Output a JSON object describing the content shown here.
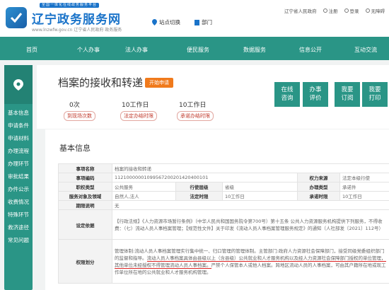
{
  "header": {
    "tagline": "全国一体化在线政务服务平台",
    "site_name": "辽宁政务服务网",
    "site_sub": "www.lnzwfw.gov.cn  辽宁省人民政府 政务服务",
    "site_switch": "站点切换",
    "dept": "部门",
    "gov_link": "辽宁省人民政府",
    "register": "注册",
    "login": "登录",
    "accessibility": "无障碍"
  },
  "nav": [
    "首页",
    "个人办事",
    "法人办事",
    "便民服务",
    "数据服务",
    "信息公开",
    "互动交流"
  ],
  "sidebar": {
    "items": [
      "基本信息",
      "申请条件",
      "申请材料",
      "办理流程",
      "办理环节",
      "审批结果",
      "办件公示",
      "收费情况",
      "特殊环节",
      "救济途径",
      "常见问题"
    ]
  },
  "service": {
    "title": "档案的接收和转递",
    "badge": "开始申请",
    "stats": [
      {
        "value": "0次",
        "label": "到现场次数"
      },
      {
        "value": "10工作日",
        "label": "法定办结时限"
      },
      {
        "value": "10工作日",
        "label": "承诺办结时限"
      }
    ],
    "actions": [
      {
        "line1": "在线",
        "line2": "咨询"
      },
      {
        "line1": "办事",
        "line2": "评价"
      },
      {
        "line1": "我要",
        "line2": "订阅"
      },
      {
        "line1": "我要",
        "line2": "打印"
      }
    ]
  },
  "basic_info": {
    "title": "基本信息",
    "rows": {
      "item_name_k": "事项名称",
      "item_name_v": "档案的接收和转递",
      "item_code_k": "事项编码",
      "item_code_v": "112100000010995672002014204001​01",
      "power_source_k": "权力来源",
      "power_source_v": "法定本级行使",
      "item_type_k": "职权类型",
      "item_type_v": "公共服务",
      "level_k": "行使层级",
      "level_v": "省级",
      "handle_type_k": "办理类型",
      "handle_type_v": "承诺件",
      "target_k": "服务对象及领域",
      "target_v": "自然人,法人",
      "legal_limit_k": "法定时限",
      "legal_limit_v": "10工作日",
      "promise_limit_k": "承诺时限",
      "promise_limit_v": "10工作日",
      "limit_note_k": "期限说明",
      "limit_note_v": "无",
      "basis_k": "设定依据",
      "basis_v": "【行政法规】《人力资源市场暂行条例》（中华人民共和国国务院令第700号）第十五条 公共人力资源服务机构提供下列服务，不得收费：（七）流动人员人事档案管理；【规范性文件】关于印发《流动人员人事档案管理服务规定》的通知（人社部发〔2021〕112号）",
      "division_k": "权限划分",
      "division_v1": "管理体制:流动人员人事档案管理实行集中统一、归口管理的管理体制。主管部门:政府人力资源社会保障部门，接受同级党委组织部门的监督和指导。",
      "division_v2": "流动人员人事档案具体由县级以上（含县级）公共就业和人才服务机构以及经人力资源社会保障部门授权的单位管理，其他单位未经授权不得管理流动人员人事档案。",
      "division_v3": "严禁个人保管本人或他人档案。跨地区流动人员的人事档案，可由其户籍所在地或现工作单位所在地的公共就业和人才服务机构管理。"
    }
  },
  "colors": {
    "primary": "#2a9586",
    "brand_blue": "#1a73c9",
    "accent_orange": "#f07a1c",
    "stat_red": "#c0392b"
  }
}
